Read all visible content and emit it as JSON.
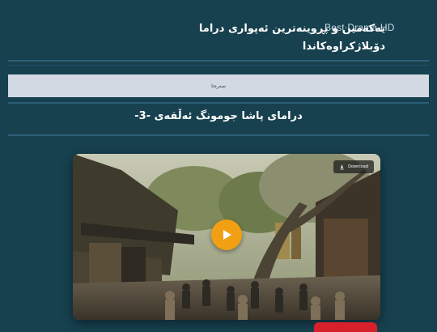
{
  "header": {
    "brand": "Best Drama HD",
    "tagline": "یەکەمین و پڕوینەترین ئەپواری دراما دۆبلاژکراوەکاندا"
  },
  "nav": {
    "home_label": "سەرەتا"
  },
  "main": {
    "title": "درامای پاشا جومونگ ئەڵقەی -3-"
  },
  "player": {
    "download_label": "Download",
    "download_icon": "download-icon",
    "play_icon": "play-icon",
    "play_color": "#f0a012"
  },
  "colors": {
    "background": "#17414f",
    "nav_bar": "#d3d9e3",
    "divider": "#2d5f7a",
    "accent_red": "#d6202a"
  }
}
